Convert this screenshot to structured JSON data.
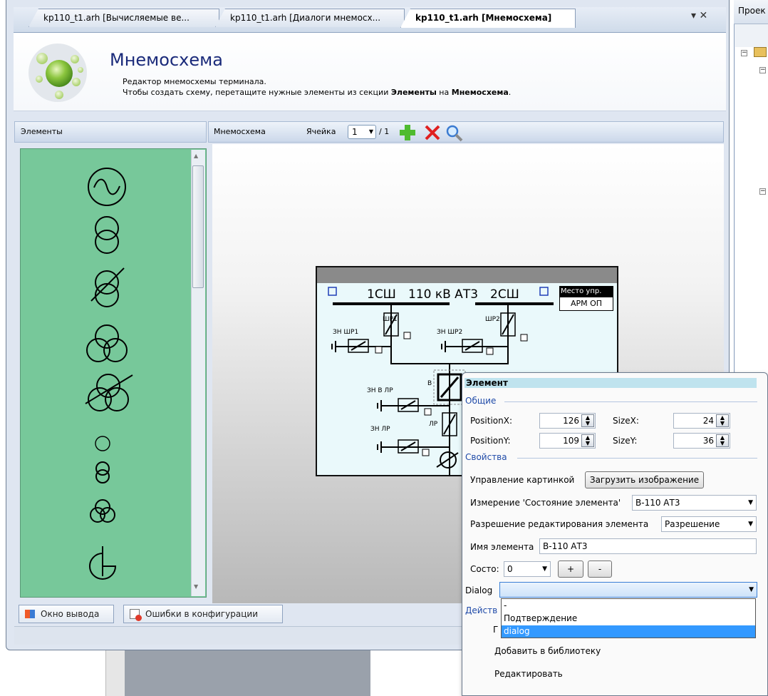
{
  "tabs": [
    {
      "label": "kp110_t1.arh [Вычисляемые ве..."
    },
    {
      "label": "kp110_t1.arh [Диалоги мнемосх..."
    },
    {
      "label": "kp110_t1.arh [Мнемосхема]"
    }
  ],
  "tab_controls": "▾ ✕",
  "right_panel": {
    "title": "Проек"
  },
  "header": {
    "title": "Мнемосхема",
    "desc1": "Редактор мнемосхемы терминала.",
    "desc2_prefix": "Чтобы создать схему, перетащите нужные элементы из секции ",
    "desc2_b1": "Элементы",
    "desc2_mid": " на ",
    "desc2_b2": "Мнемосхема",
    "desc2_suffix": "."
  },
  "elements_panel": {
    "title": "Элементы"
  },
  "schema_toolbar": {
    "title": "Мнемосхема",
    "cell_label": "Ячейка",
    "cell_value": "1",
    "cell_total": "/ 1"
  },
  "schema": {
    "bus1": "1СШ",
    "voltage": "110 кВ АТ3",
    "bus2": "2СШ",
    "control_place": "Место упр.",
    "control_value": "АРМ ОП",
    "shr1": "ШР1",
    "zn_shr1": "ЗН ШР1",
    "shr2": "ШР2",
    "zn_shr2": "ЗН ШР2",
    "zn_v_lr": "ЗН В ЛР",
    "zn_lr": "ЗН ЛР",
    "lr": "ЛР",
    "v": "В"
  },
  "bottom_tabs": [
    {
      "label": "Окно вывода"
    },
    {
      "label": "Ошибки в конфигурации"
    }
  ],
  "properties": {
    "title": "Элемент",
    "general": "Общие",
    "position_x_label": "PositionX:",
    "position_x": "126",
    "size_x_label": "SizeX:",
    "size_x": "24",
    "position_y_label": "PositionY:",
    "position_y": "109",
    "size_y_label": "SizeY:",
    "size_y": "36",
    "props_section": "Свойства",
    "picture_label": "Управление картинкой",
    "picture_button": "Загрузить изображение",
    "measure_label": "Измерение 'Состояние элемента'",
    "measure_value": "В-110 АТ3",
    "edit_perm_label": "Разрешение редактирования элемента",
    "edit_perm_value": "Разрешение",
    "name_label": "Имя элемента",
    "name_value": "В-110 АТ3",
    "state_label": "Состо:",
    "state_value": "0",
    "plus": "+",
    "minus": "-",
    "dialog_label": "Dialog",
    "dialog_value": "",
    "actions_section": "Действ",
    "action_partial": "Г",
    "add_to_library": "Добавить в библиотеку",
    "edit": "Редактировать"
  },
  "dialog_options": [
    "-",
    "Подтверждение",
    "dialog"
  ],
  "dialog_selected": "dialog",
  "colors": {
    "elements_bg": "#77c89a",
    "title_color": "#1a2a7a",
    "section_color": "#1f4aa8",
    "selection": "#3399ff",
    "props_title_bg": "#bfe3ee"
  }
}
